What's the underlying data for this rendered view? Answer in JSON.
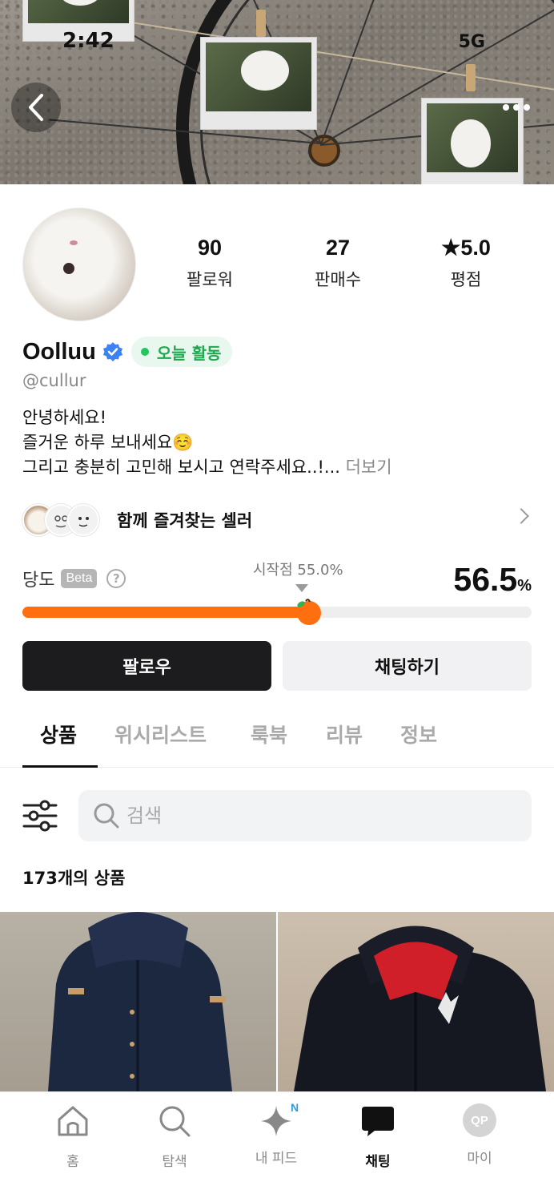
{
  "status_bar": {
    "time": "2:42",
    "right_text": "5G"
  },
  "profile": {
    "name": "Oolluu",
    "handle": "@cullur",
    "active_badge": "오늘 활동",
    "stats": [
      {
        "value": "90",
        "label": "팔로워"
      },
      {
        "value": "27",
        "label": "판매수"
      },
      {
        "value": "5.0",
        "label": "평점"
      }
    ],
    "bio_lines": [
      "안녕하세요!",
      "즐거운 하루 보내세요☺️",
      "그리고 충분히 고민해 보시고 연락주세요..!..."
    ],
    "bio_more": "더보기",
    "fav_sellers_label": "함께 즐겨찾는 셀러"
  },
  "temperature": {
    "label": "당도",
    "beta": "Beta",
    "help": "?",
    "start_label": "시작점 55.0%",
    "value": "56.5",
    "unit": "%",
    "fill_percent": 56.5
  },
  "actions": {
    "follow": "팔로우",
    "chat": "채팅하기"
  },
  "tabs": [
    {
      "label": "상품",
      "active": true
    },
    {
      "label": "위시리스트",
      "active": false
    },
    {
      "label": "룩북",
      "active": false
    },
    {
      "label": "리뷰",
      "active": false
    },
    {
      "label": "정보",
      "active": false
    }
  ],
  "search": {
    "placeholder": "검색",
    "value": ""
  },
  "product_count": "173개의 상품",
  "bottom_nav": [
    {
      "label": "홈",
      "icon": "home-icon"
    },
    {
      "label": "탐색",
      "icon": "search-icon"
    },
    {
      "label": "내 피드",
      "icon": "sparkle-icon",
      "badge": "N"
    },
    {
      "label": "채팅",
      "icon": "chat-icon",
      "active": true
    },
    {
      "label": "마이",
      "icon": "profile-qp-icon",
      "avatar_text": "QP"
    }
  ],
  "colors": {
    "accent": "#ff6f0f",
    "active_green": "#22c55e",
    "verified_blue": "#3b82f6",
    "follow_bg": "#1c1c1e"
  }
}
